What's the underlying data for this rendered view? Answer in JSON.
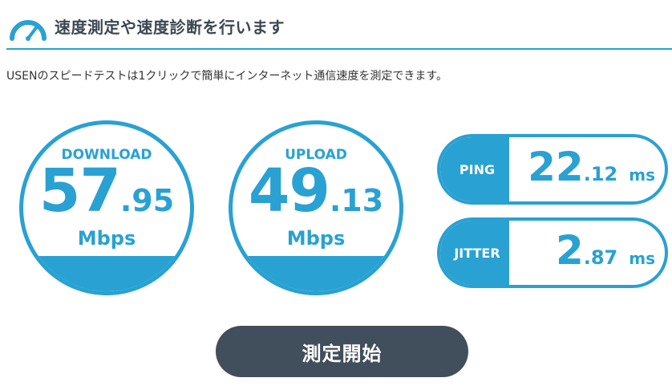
{
  "header": {
    "icon": "speedometer-icon",
    "title": "速度測定や速度診断を行います"
  },
  "description": "USENのスピードテストは1クリックで簡単にインターネット通信速度を測定できます。",
  "download": {
    "label": "DOWNLOAD",
    "value_int": "57",
    "value_dec": ".95",
    "unit": "Mbps"
  },
  "upload": {
    "label": "UPLOAD",
    "value_int": "49",
    "value_dec": ".13",
    "unit": "Mbps"
  },
  "ping": {
    "label": "PING",
    "value_int": "22",
    "value_dec": ".12",
    "unit": "ms"
  },
  "jitter": {
    "label": "JITTER",
    "value_int": "2",
    "value_dec": ".87",
    "unit": "ms"
  },
  "start_button": {
    "label": "測定開始"
  },
  "colors": {
    "accent": "#29a1d3",
    "button": "#414e5c",
    "title": "#3d4752"
  }
}
